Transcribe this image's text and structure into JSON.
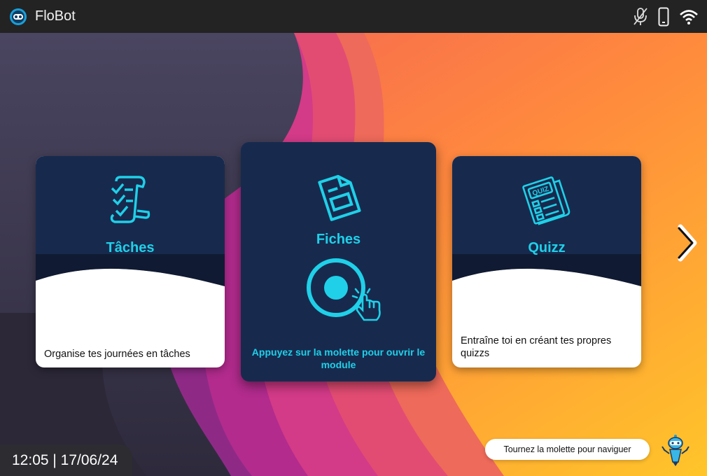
{
  "app": {
    "title": "FloBot"
  },
  "status_icons": [
    "mic-muted-icon",
    "phone-icon",
    "wifi-icon"
  ],
  "cards": [
    {
      "title": "Tâches",
      "description": "Organise tes journées en tâches",
      "icon": "task-list-icon"
    },
    {
      "title": "Fiches",
      "hint": "Appuyez sur la molette pour ouvrir le module",
      "icon": "document-icon"
    },
    {
      "title": "Quizz",
      "description": "Entraîne toi en créant tes propres quizzs",
      "icon": "quiz-newspaper-icon"
    }
  ],
  "footer": {
    "time": "12:05",
    "date": "17/06/24",
    "clock_text": "12:05 | 17/06/24",
    "nav_hint": "Tournez la molette pour naviguer"
  },
  "colors": {
    "card_dark": "#172a4e",
    "accent": "#1fd0e8",
    "topbar": "#232323"
  }
}
